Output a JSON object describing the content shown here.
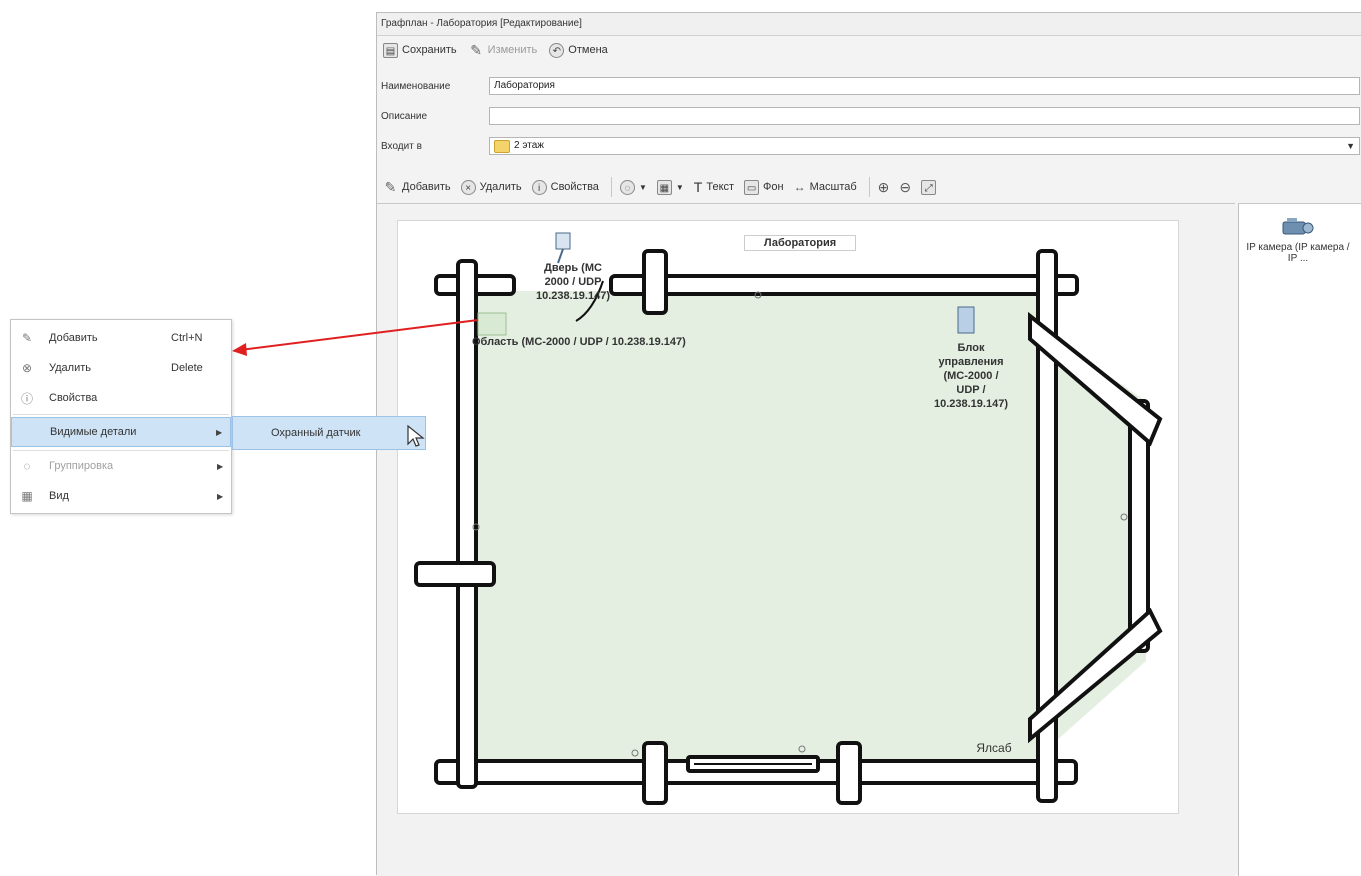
{
  "window": {
    "title": "Графплан - Лаборатория [Редактирование]"
  },
  "toolbar1": {
    "save": "Сохранить",
    "edit": "Изменить",
    "cancel": "Отмена"
  },
  "form": {
    "name_label": "Наименование",
    "name_value": "Лаборатория",
    "description_label": "Описание",
    "description_value": "",
    "parent_label": "Входит в",
    "parent_value": "2 этаж"
  },
  "toolbar2": {
    "add": "Добавить",
    "delete": "Удалить",
    "properties": "Свойства",
    "text": "Текст",
    "background": "Фон",
    "scale": "Масштаб"
  },
  "plan": {
    "room_title": "Лаборатория",
    "door_label": "Дверь (МС-2000 / UDP / 10.238.19.147)",
    "door_line1": "Дверь (МС",
    "door_line2": "2000 / UDP",
    "door_line3": "10.238.19.147)",
    "area_label": "Область (МС-2000 / UDP / 10.238.19.147)",
    "control_line1": "Блок",
    "control_line2": "управления",
    "control_line3": "(МС-2000 /",
    "control_line4": "UDP /",
    "control_line5": "10.238.19.147)",
    "partial_label": "Ялсаб"
  },
  "right_panel": {
    "item_label": "IP камера (IP камера / IP ..."
  },
  "context_menu": {
    "items": [
      {
        "label": "Добавить",
        "shortcut": "Ctrl+N",
        "icon": "pen-icon"
      },
      {
        "label": "Удалить",
        "shortcut": "Delete",
        "icon": "delete-icon"
      },
      {
        "label": "Свойства",
        "shortcut": "",
        "icon": "properties-icon"
      },
      {
        "label": "Видимые детали",
        "shortcut": "",
        "icon": ""
      },
      {
        "label": "Группировка",
        "shortcut": "",
        "icon": "group-icon"
      },
      {
        "label": "Вид",
        "shortcut": "",
        "icon": "view-icon"
      }
    ],
    "submenu_item": "Охранный датчик"
  },
  "colors": {
    "room_fill": "#e4efe2",
    "wall": "#111111",
    "menu_highlight": "#cfe3f7",
    "arrow": "#e02020"
  }
}
